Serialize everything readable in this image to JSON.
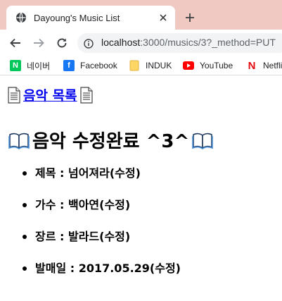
{
  "browser": {
    "tab_title": "Dayoung's Music List",
    "url_host": "localhost",
    "url_rest": ":3000/musics/3?_method=PUT"
  },
  "bookmarks": [
    {
      "label": "네이버",
      "icon": "naver-icon",
      "color": "#03c75a",
      "glyph": "N"
    },
    {
      "label": "Facebook",
      "icon": "facebook-icon",
      "color": "#1877f2",
      "glyph": "f"
    },
    {
      "label": "INDUK",
      "icon": "folder-icon",
      "color": "#fdd663",
      "glyph": ""
    },
    {
      "label": "YouTube",
      "icon": "youtube-icon",
      "color": "#ff0000",
      "glyph": ""
    },
    {
      "label": "Netflix",
      "icon": "netflix-icon",
      "color": "#e50914",
      "glyph": "N"
    }
  ],
  "page": {
    "list_link": "음악 목록",
    "heading": "음악 수정완료 ^3^",
    "details": [
      "제목 : 넘어져라(수정)",
      "가수 : 백아연(수정)",
      "장르 : 발라드(수정)",
      "발매일 : 2017.05.29(수정)"
    ]
  },
  "colors": {
    "tab_strip": "#f0c9c3",
    "link": "#0000ee"
  }
}
